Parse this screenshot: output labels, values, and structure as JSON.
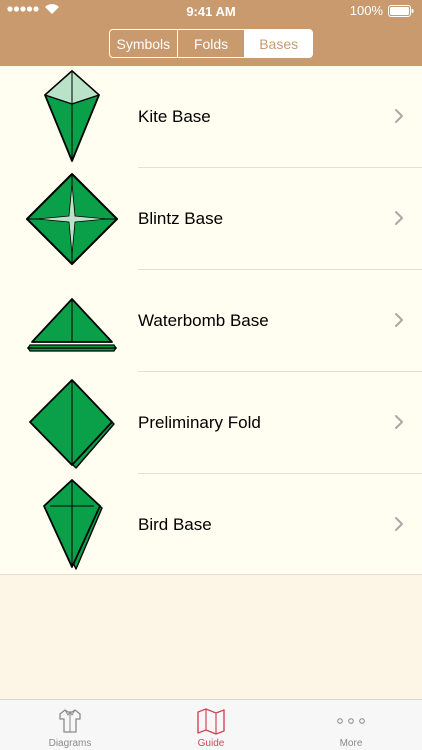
{
  "status": {
    "time": "9:41 AM",
    "battery": "100%"
  },
  "segments": [
    {
      "label": "Symbols",
      "active": false
    },
    {
      "label": "Folds",
      "active": false
    },
    {
      "label": "Bases",
      "active": true
    }
  ],
  "bases": [
    {
      "label": "Kite Base",
      "icon": "kite-base-icon"
    },
    {
      "label": "Blintz Base",
      "icon": "blintz-base-icon"
    },
    {
      "label": "Waterbomb Base",
      "icon": "waterbomb-base-icon"
    },
    {
      "label": "Preliminary Fold",
      "icon": "preliminary-fold-icon"
    },
    {
      "label": "Bird Base",
      "icon": "bird-base-icon"
    }
  ],
  "tabs": [
    {
      "label": "Diagrams",
      "icon": "shirt-icon"
    },
    {
      "label": "Guide",
      "icon": "map-icon"
    },
    {
      "label": "More",
      "icon": "more-icon"
    }
  ],
  "colors": {
    "header": "#c99a6e",
    "list_bg": "#fffef0",
    "page_bg": "#fdf5e6",
    "origami_green": "#0aa04a",
    "origami_light": "#b9e2c8",
    "active_tab": "#d0485a"
  }
}
